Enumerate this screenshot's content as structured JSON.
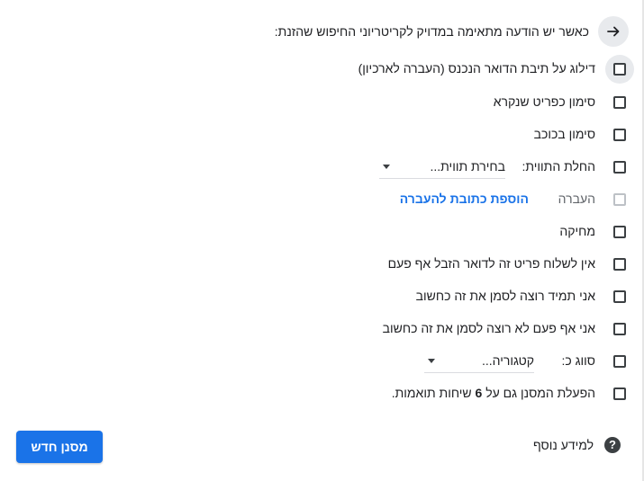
{
  "header": {
    "text": "כאשר יש הודעה מתאימה במדויק לקריטריוני החיפוש שהזנת:",
    "arrow_icon": "arrow-right-icon"
  },
  "actions": [
    {
      "key": "skip_inbox",
      "label": "דילוג על תיבת הדואר הנכנס (העברה לארכיון)",
      "checked": false,
      "focused": true
    },
    {
      "key": "mark_read",
      "label": "סימון כפריט שנקרא",
      "checked": false
    },
    {
      "key": "star",
      "label": "סימון בכוכב",
      "checked": false
    },
    {
      "key": "apply_label",
      "label": "החלת התווית:",
      "select_value": "בחירת תווית...",
      "checked": false
    },
    {
      "key": "forward",
      "label": "העברה",
      "link": "הוספת כתובת להעברה",
      "checked": false,
      "disabled": true
    },
    {
      "key": "delete",
      "label": "מחיקה",
      "checked": false
    },
    {
      "key": "never_spam",
      "label": "אין לשלוח פריט זה לדואר הזבל אף פעם",
      "checked": false
    },
    {
      "key": "always_important",
      "label": "אני תמיד רוצה לסמן את זה כחשוב",
      "checked": false
    },
    {
      "key": "never_important",
      "label": "אני אף פעם לא רוצה לסמן את זה כחשוב",
      "checked": false
    },
    {
      "key": "categorize",
      "label": "סווג כ:",
      "select_value": "קטגוריה...",
      "checked": false
    },
    {
      "key": "apply_matching",
      "label_before": "הפעלת המסנן גם על",
      "count": "6",
      "label_after": "שיחות תואמות.",
      "checked": false
    }
  ],
  "footer": {
    "help_label": "למידע נוסף",
    "help_icon": "help-circle-icon",
    "create_button": "מסנן חדש"
  },
  "colors": {
    "accent": "#1a73e8",
    "text": "#202124",
    "checkbox_border": "#3c4043",
    "disabled": "#bdc1c6"
  }
}
